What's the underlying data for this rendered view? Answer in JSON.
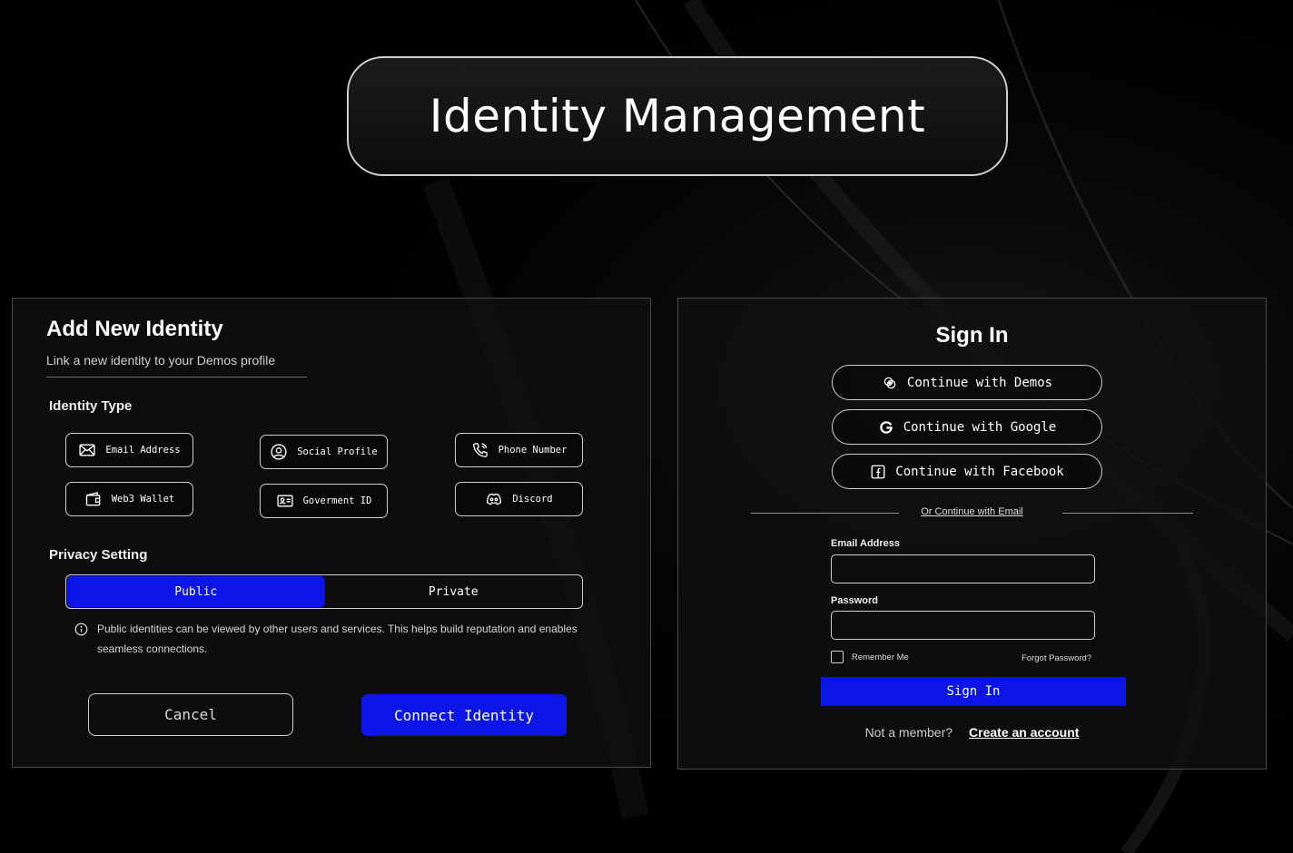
{
  "hero": {
    "title": "Identity Management"
  },
  "add_identity": {
    "title": "Add New Identity",
    "subtitle": "Link a new identity to your Demos profile",
    "identity_type_label": "Identity Type",
    "identity_types": [
      {
        "label": "Email Address",
        "icon": "envelope-icon"
      },
      {
        "label": "Social Profile",
        "icon": "user-circle-icon"
      },
      {
        "label": "Phone Number",
        "icon": "phone-icon"
      },
      {
        "label": "Web3 Wallet",
        "icon": "wallet-icon"
      },
      {
        "label": "Goverment ID",
        "icon": "id-card-icon"
      },
      {
        "label": "Discord",
        "icon": "discord-icon"
      }
    ],
    "privacy_label": "Privacy Setting",
    "privacy_options": {
      "public": "Public",
      "private": "Private",
      "selected": "Public"
    },
    "privacy_info": "Public identities can be viewed by other users and services. This helps build reputation and enables seamless connections.",
    "cancel_label": "Cancel",
    "connect_label": "Connect Identity"
  },
  "sign_in": {
    "title": "Sign In",
    "oauth": [
      {
        "label": "Continue with Demos",
        "icon": "demos-logo-icon"
      },
      {
        "label": "Continue with Google",
        "icon": "google-icon"
      },
      {
        "label": "Continue with Facebook",
        "icon": "facebook-icon"
      }
    ],
    "divider_text": "Or Continue with Email",
    "email_label": "Email Address",
    "email_value": "",
    "password_label": "Password",
    "password_value": "",
    "remember_label": "Remember Me",
    "forgot_label": "Forgot Password?",
    "submit_label": "Sign In",
    "member_question": "Not a member?",
    "create_account": "Create an account"
  },
  "colors": {
    "accent": "#0b16e6",
    "background": "#000000",
    "border": "#cfcfcf"
  }
}
